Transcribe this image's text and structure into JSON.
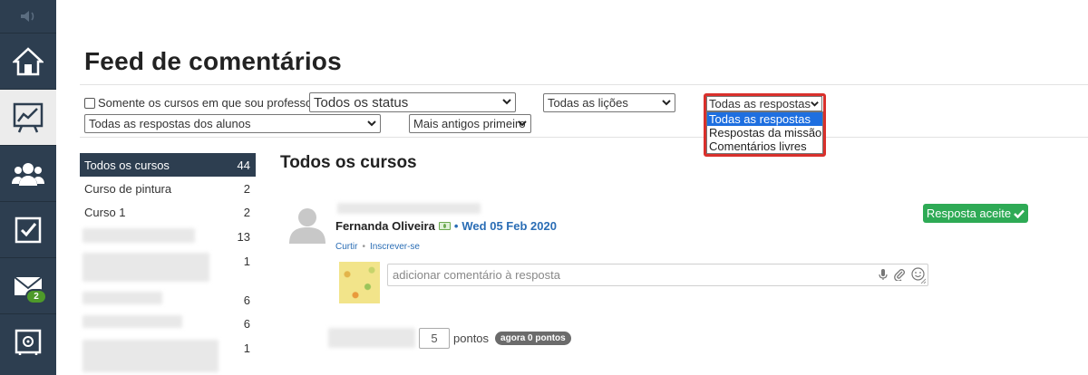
{
  "page": {
    "title": "Feed de comentários"
  },
  "filters": {
    "only_my_courses_label": "Somente os cursos em que sou professor",
    "status_value": "Todos os status",
    "lessons_value": "Todas as lições",
    "responses_value": "Todas as respostas",
    "responses_options": [
      "Todas as respostas",
      "Respostas da missão",
      "Comentários livres"
    ],
    "students_value": "Todas as respostas dos alunos",
    "order_value": "Mais antigos primeiro"
  },
  "sidebar_nav": {
    "badge_count": "2"
  },
  "courses": [
    {
      "name": "Todos os cursos",
      "count": "44",
      "active": true
    },
    {
      "name": "Curso de pintura",
      "count": "2"
    },
    {
      "name": "Curso 1",
      "count": "2"
    },
    {
      "name": "",
      "count": "13"
    },
    {
      "name": "",
      "count": "1"
    },
    {
      "name": "",
      "count": "6"
    },
    {
      "name": "",
      "count": "6"
    },
    {
      "name": "",
      "count": "1"
    }
  ],
  "main": {
    "section_title": "Todos os cursos",
    "post": {
      "author": "Fernanda Oliveira",
      "separator": "•",
      "date": "Wed 05 Feb 2020",
      "like_label": "Curtir",
      "subscribe_label": "Inscrever-se",
      "accepted_label": "Resposta aceite",
      "comment_placeholder": "adicionar comentário à resposta"
    },
    "points": {
      "value": "5",
      "unit_label": "pontos",
      "badge": "agora 0 pontos"
    }
  },
  "colors": {
    "rail": "#2d3e50",
    "accent_green": "#2eaa55",
    "highlight_red": "#d9302c",
    "selected_blue": "#1e6fe0"
  }
}
